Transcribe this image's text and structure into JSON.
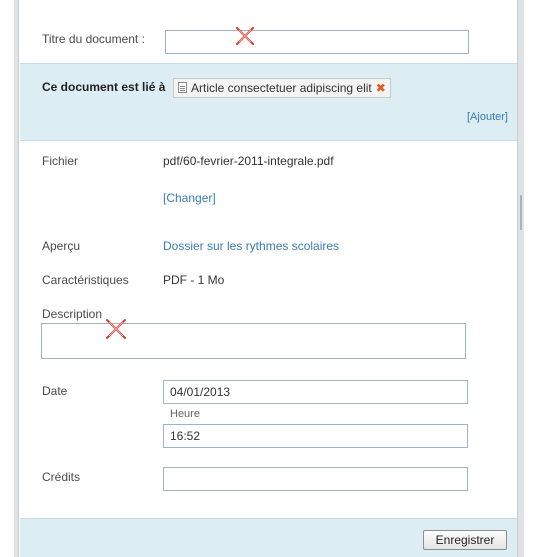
{
  "form": {
    "title_label": "Titre du document :",
    "title_value": "",
    "linked_label": "Ce document est lié à",
    "linked_item": "Article consectetuer adipiscing elit",
    "add_link": "[Ajouter]",
    "file_label": "Fichier",
    "file_value": "pdf/60-fevrier-2011-integrale.pdf",
    "change_link": "[Changer]",
    "preview_label": "Aperçu",
    "preview_link": "Dossier sur les rythmes scolaires",
    "characteristics_label": "Caractéristiques",
    "characteristics_value": "PDF - 1 Mo",
    "description_label": "Description",
    "description_value": "",
    "date_label": "Date",
    "date_value": "04/01/2013",
    "time_label": "Heure",
    "time_value": "16:52",
    "credits_label": "Crédits",
    "credits_value": "",
    "save_button": "Enregistrer"
  },
  "icons": {
    "linked_doc": "document-icon",
    "remove": "remove-x-icon",
    "missing_marker": "red-x-marker-icon"
  },
  "colors": {
    "band": "#dcedf4",
    "link": "#3a7bb0",
    "remove": "#e05a1a",
    "marker": "#d9362b"
  }
}
